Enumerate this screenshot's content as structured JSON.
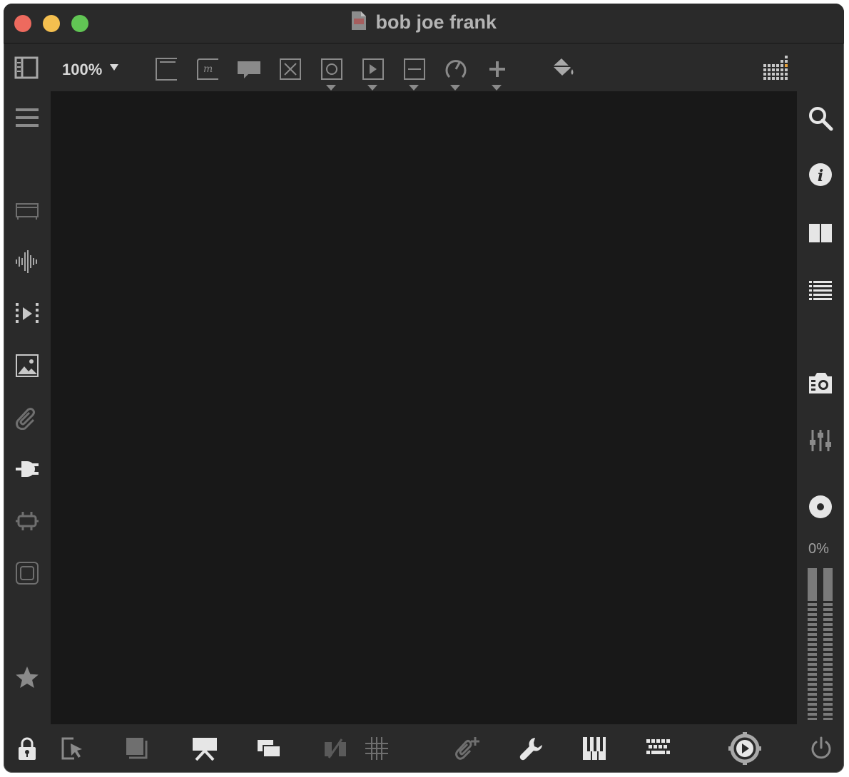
{
  "window": {
    "title": "bob joe frank"
  },
  "toolbar": {
    "zoom": "100%",
    "icons": {
      "sidebar_toggle": "sidebar-toggle-icon",
      "new_object": "object-box-icon",
      "message": "message-box-icon",
      "comment": "comment-icon",
      "toggle": "toggle-x-icon",
      "button": "button-circle-icon",
      "play": "play-box-icon",
      "slider": "slider-icon",
      "dial": "dial-icon",
      "add": "plus-icon",
      "paint": "paint-bucket-icon",
      "grid_presentation": "grid-matrix-icon"
    }
  },
  "left_sidebar": {
    "items": [
      "menu-lines-icon",
      "object-palette-icon",
      "audio-waveform-icon",
      "video-icon",
      "image-icon",
      "attachment-icon",
      "plugin-icon",
      "connector-icon",
      "frame-icon",
      "star-icon"
    ]
  },
  "right_sidebar": {
    "items": [
      "search-icon",
      "info-icon",
      "book-icon",
      "list-icon",
      "camera-icon",
      "mixer-icon",
      "record-icon"
    ],
    "cpu_label": "0%"
  },
  "bottom_bar": {
    "items": [
      "lock-icon",
      "edit-cursor-icon",
      "presentation-back-icon",
      "presentation-mode-icon",
      "windows-icon",
      "patch-cords-icon",
      "grid-icon",
      "add-attachment-icon",
      "wrench-icon",
      "piano-keys-icon",
      "keyboard-icon",
      "audio-on-icon",
      "power-icon"
    ]
  },
  "colors": {
    "window_bg": "#2a2a2a",
    "canvas_bg": "#181818",
    "icon": "#a8a8a8",
    "icon_bright": "#e6e6e6",
    "close": "#ed6a5e",
    "minimize": "#f4bf4f",
    "maximize": "#61c554"
  }
}
